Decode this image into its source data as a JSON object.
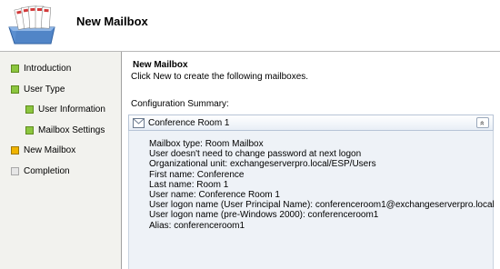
{
  "header": {
    "title": "New Mailbox",
    "icon": "mailbox-tray-icon"
  },
  "steps": [
    {
      "label": "Introduction",
      "status": "done",
      "indent": 0
    },
    {
      "label": "User Type",
      "status": "done",
      "indent": 0
    },
    {
      "label": "User Information",
      "status": "done",
      "indent": 1
    },
    {
      "label": "Mailbox Settings",
      "status": "done",
      "indent": 1
    },
    {
      "label": "New Mailbox",
      "status": "current",
      "indent": 0
    },
    {
      "label": "Completion",
      "status": "pending",
      "indent": 0
    }
  ],
  "colors": {
    "done": "#8cc63f",
    "current": "#f0b400",
    "pending": "#e6e6e6"
  },
  "main": {
    "title": "New Mailbox",
    "description": "Click New to create the following mailboxes.",
    "config_label": "Configuration Summary:",
    "panel": {
      "title": "Conference Room 1",
      "collapse_glyph": "«",
      "details": [
        "Mailbox type: Room Mailbox",
        "User doesn't need to change password at next logon",
        "Organizational unit: exchangeserverpro.local/ESP/Users",
        "First name: Conference",
        "Last name: Room 1",
        "User name: Conference Room 1",
        "User logon name (User Principal Name): conferenceroom1@exchangeserverpro.local",
        "User logon name (pre-Windows 2000): conferenceroom1",
        "Alias: conferenceroom1"
      ]
    }
  }
}
